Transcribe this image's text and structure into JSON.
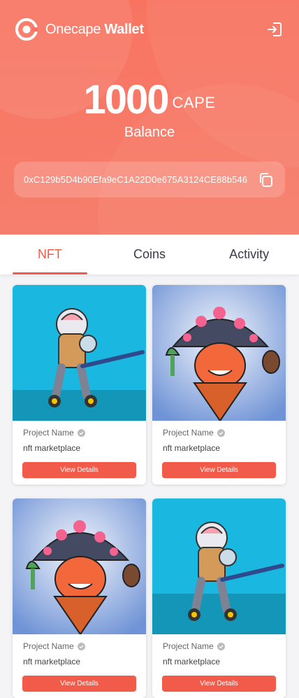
{
  "header": {
    "brand_light": "Onecape",
    "brand_bold": "Wallet",
    "balance_amount": "1000",
    "balance_unit": "CAPE",
    "balance_label": "Balance",
    "wallet_address": "0xC129b5D4b90Efa9eC1A22D0e675A3124CE88b546"
  },
  "tabs": [
    {
      "label": "NFT",
      "active": true
    },
    {
      "label": "Coins",
      "active": false
    },
    {
      "label": "Activity",
      "active": false
    }
  ],
  "nfts": [
    {
      "project": "Project Name",
      "description": "nft marketplace",
      "button": "View Details",
      "art": "astronaut-robot-icon"
    },
    {
      "project": "Project Name",
      "description": "nft marketplace",
      "button": "View Details",
      "art": "mushroom-character-icon"
    },
    {
      "project": "Project Name",
      "description": "nft marketplace",
      "button": "View Details",
      "art": "mushroom-character-icon"
    },
    {
      "project": "Project Name",
      "description": "nft marketplace",
      "button": "View Details",
      "art": "astronaut-robot-icon"
    }
  ],
  "colors": {
    "accent": "#f25b4a",
    "header": "#f87461",
    "cyan_bg": "#1ab8e0"
  }
}
